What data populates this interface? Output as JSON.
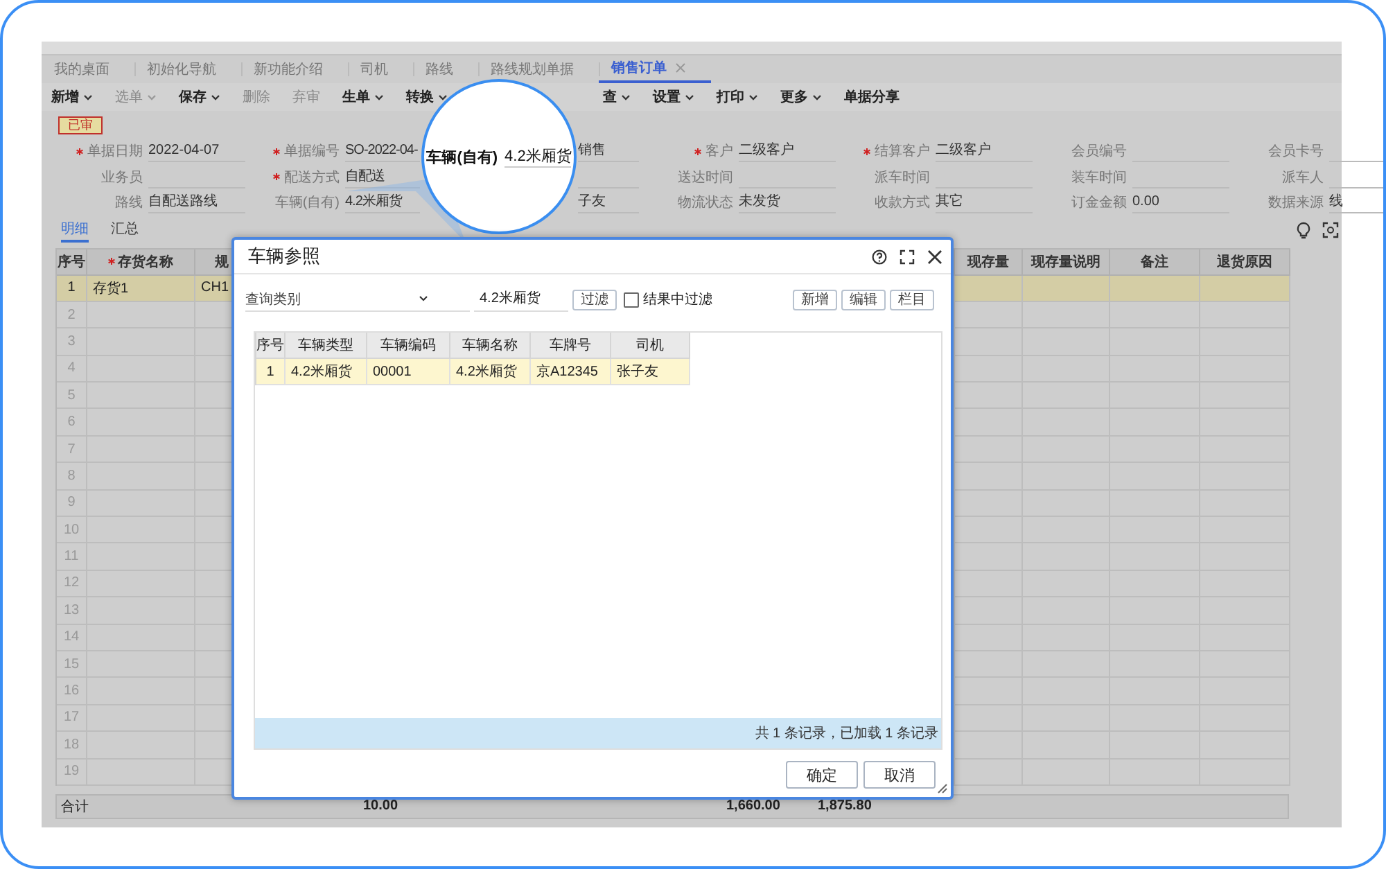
{
  "nav_tabs": [
    {
      "label": "我的桌面",
      "selected": false,
      "closable": false
    },
    {
      "label": "初始化导航",
      "selected": false,
      "closable": false
    },
    {
      "label": "新功能介绍",
      "selected": false,
      "closable": false
    },
    {
      "label": "司机",
      "selected": false,
      "closable": false
    },
    {
      "label": "路线",
      "selected": false,
      "closable": false
    },
    {
      "label": "路线规划单据",
      "selected": false,
      "closable": false
    },
    {
      "label": "销售订单",
      "selected": true,
      "closable": true
    }
  ],
  "toolbar": [
    {
      "label": "新增",
      "disabled": false,
      "dropdown": true
    },
    {
      "label": "选单",
      "disabled": true,
      "dropdown": true
    },
    {
      "label": "保存",
      "disabled": false,
      "dropdown": true
    },
    {
      "label": "删除",
      "disabled": true,
      "dropdown": false
    },
    {
      "label": "弃审",
      "disabled": true,
      "dropdown": false
    },
    {
      "label": "生单",
      "disabled": false,
      "dropdown": true
    },
    {
      "label": "转换",
      "disabled": false,
      "dropdown": true
    },
    {
      "label": "查",
      "disabled": false,
      "dropdown": true
    },
    {
      "label": "设置",
      "disabled": false,
      "dropdown": true
    },
    {
      "label": "打印",
      "disabled": false,
      "dropdown": true
    },
    {
      "label": "更多",
      "disabled": false,
      "dropdown": true
    },
    {
      "label": "单据分享",
      "disabled": false,
      "dropdown": false
    }
  ],
  "status_badge": "已审",
  "form_rows": [
    [
      {
        "label": "单据日期",
        "required": true,
        "value": "2022-04-07"
      },
      {
        "label": "单据编号",
        "required": true,
        "value": "SO-2022-04-"
      },
      {
        "value": "销售"
      },
      {
        "label": "客户",
        "required": true,
        "value": "二级客户"
      },
      {
        "label": "结算客户",
        "required": true,
        "value": "二级客户"
      },
      {
        "label": "会员编号",
        "required": false
      },
      {
        "label": "会员卡号",
        "required": false
      }
    ],
    [
      {
        "label": "业务员",
        "required": false
      },
      {
        "label": "配送方式",
        "required": true,
        "value": "自配送"
      },
      {},
      {
        "label": "送达时间",
        "required": false
      },
      {
        "label": "派车时间",
        "required": false
      },
      {
        "label": "装车时间",
        "required": false
      },
      {
        "label": "派车人",
        "required": false
      }
    ],
    [
      {
        "label": "路线",
        "required": false,
        "value": "自配送路线"
      },
      {
        "label": "车辆(自有)",
        "required": false,
        "value": "4.2米厢货"
      },
      {
        "value": "子友"
      },
      {
        "label": "物流状态",
        "required": false,
        "value": "未发货"
      },
      {
        "label": "收款方式",
        "required": false,
        "value": "其它"
      },
      {
        "label": "订金金额",
        "required": false,
        "value": "0.00"
      },
      {
        "label": "数据来源",
        "required": false,
        "value": "线"
      }
    ]
  ],
  "detail_tabs": [
    {
      "label": "明细",
      "selected": true
    },
    {
      "label": "汇总",
      "selected": false
    }
  ],
  "grid": {
    "columns": [
      {
        "label": "序号",
        "required": false
      },
      {
        "label": "存货名称",
        "required": true
      },
      {
        "label": "规",
        "required": false
      },
      {
        "label": "现存量",
        "required": false
      },
      {
        "label": "现存量说明",
        "required": false
      },
      {
        "label": "备注",
        "required": false
      },
      {
        "label": "退货原因",
        "required": false
      }
    ],
    "rows": [
      {
        "cells": [
          "1",
          "存货1",
          "CH1"
        ],
        "selected": true
      },
      {
        "cells": [
          "2"
        ],
        "selected": false
      },
      {
        "cells": [
          "3"
        ],
        "selected": false
      },
      {
        "cells": [
          "4"
        ],
        "selected": false
      },
      {
        "cells": [
          "5"
        ],
        "selected": false
      },
      {
        "cells": [
          "6"
        ],
        "selected": false
      },
      {
        "cells": [
          "7"
        ],
        "selected": false
      },
      {
        "cells": [
          "8"
        ],
        "selected": false
      },
      {
        "cells": [
          "9"
        ],
        "selected": false
      },
      {
        "cells": [
          "10"
        ],
        "selected": false
      },
      {
        "cells": [
          "11"
        ],
        "selected": false
      },
      {
        "cells": [
          "12"
        ],
        "selected": false
      },
      {
        "cells": [
          "13"
        ],
        "selected": false
      },
      {
        "cells": [
          "14"
        ],
        "selected": false
      },
      {
        "cells": [
          "15"
        ],
        "selected": false
      },
      {
        "cells": [
          "16"
        ],
        "selected": false
      },
      {
        "cells": [
          "17"
        ],
        "selected": false
      },
      {
        "cells": [
          "18"
        ],
        "selected": false
      },
      {
        "cells": [
          "19"
        ],
        "selected": false
      }
    ],
    "totals": {
      "label": "合计",
      "values": [
        "10.00",
        "1,660.00",
        "1,875.80"
      ]
    }
  },
  "dialog": {
    "title": "车辆参照",
    "filter": {
      "category_placeholder": "查询类别",
      "search_value": "4.2米厢货",
      "filter_button": "过滤",
      "checkbox": {
        "label": "结果中过滤",
        "checked": false
      }
    },
    "action_buttons": [
      "新增",
      "编辑",
      "栏目"
    ],
    "table": {
      "columns": [
        "序号",
        "车辆类型",
        "车辆编码",
        "车辆名称",
        "车牌号",
        "司机"
      ],
      "rows": [
        {
          "cells": [
            "1",
            "4.2米厢货",
            "00001",
            "4.2米厢货",
            "京A12345",
            "张子友"
          ],
          "selected": true
        }
      ]
    },
    "status": "共 1 条记录，已加载 1 条记录",
    "buttons": [
      "确定",
      "取消"
    ]
  },
  "magnifier": {
    "label": "车辆(自有)",
    "value": "4.2米厢货"
  }
}
